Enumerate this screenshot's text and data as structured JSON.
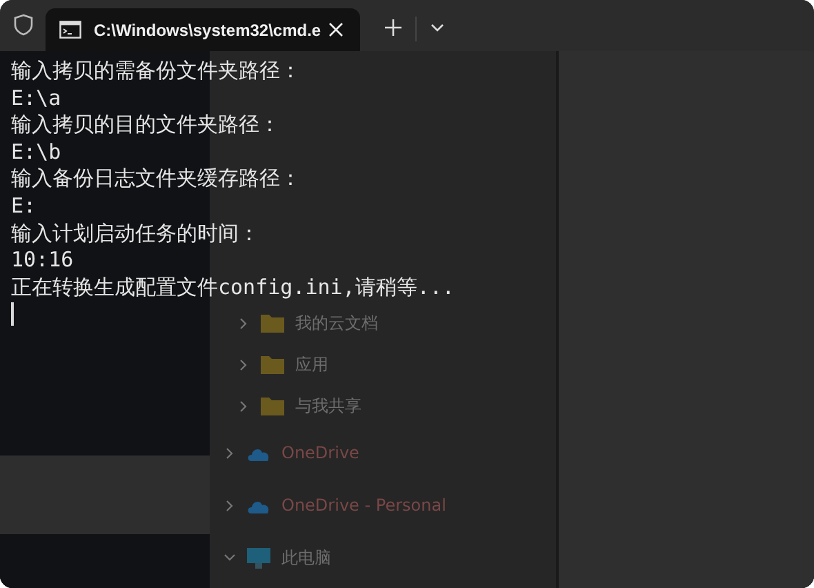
{
  "tab_bar": {
    "tabs": [
      {
        "title": "C:\\Windows\\system32\\cmd.e",
        "selected": true
      }
    ]
  },
  "terminal": {
    "lines": [
      "输入拷贝的需备份文件夹路径：",
      "E:\\a",
      "输入拷贝的目的文件夹路径：",
      "E:\\b",
      "输入备份日志文件夹缓存路径：",
      "E:",
      "输入计划启动任务的时间：",
      "10:16",
      "正在转换生成配置文件config.ini,请稍等..."
    ],
    "cursor": true
  },
  "background_explorer": {
    "nav_items": [
      {
        "label": "我的云文档",
        "kind": "folder",
        "expanded": false
      },
      {
        "label": "应用",
        "kind": "folder",
        "expanded": false
      },
      {
        "label": "与我共享",
        "kind": "folder",
        "expanded": false
      },
      {
        "label": "OneDrive",
        "kind": "cloud",
        "expanded": false
      },
      {
        "label": "OneDrive - Personal",
        "kind": "cloud",
        "expanded": false
      },
      {
        "label": "此电脑",
        "kind": "pc",
        "expanded": true
      }
    ]
  }
}
